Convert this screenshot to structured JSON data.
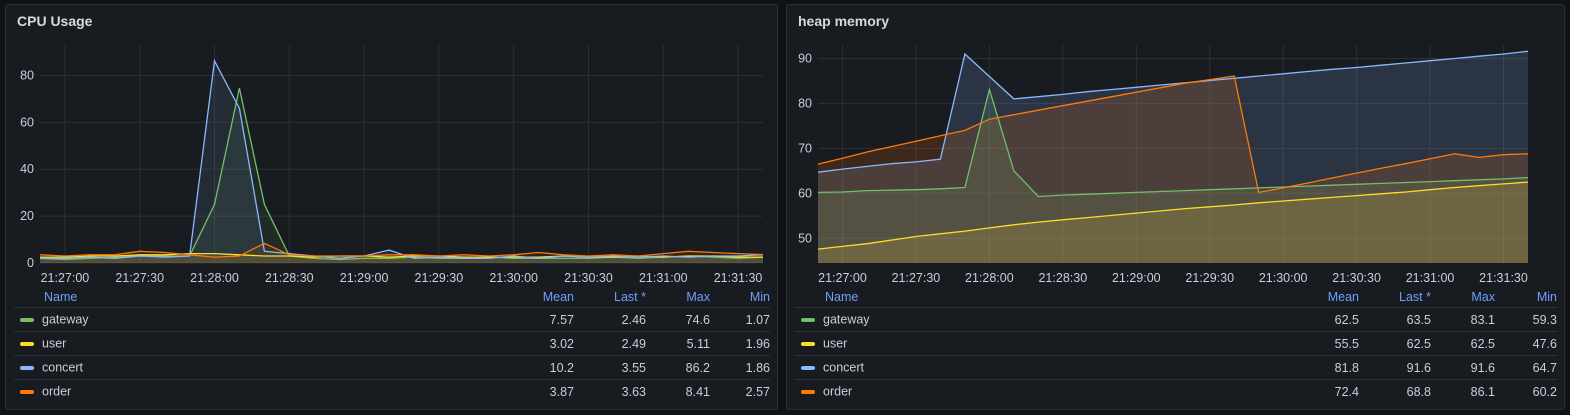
{
  "colors": {
    "gateway": "#73bf69",
    "user": "#fade2a",
    "concert": "#8ab8ff",
    "order": "#ff780a"
  },
  "panels": [
    {
      "title": "CPU Usage",
      "chart_data": {
        "type": "area",
        "x": [
          "21:26:50",
          "21:27:00",
          "21:27:10",
          "21:27:20",
          "21:27:30",
          "21:27:40",
          "21:27:50",
          "21:28:00",
          "21:28:10",
          "21:28:20",
          "21:28:30",
          "21:28:40",
          "21:28:50",
          "21:29:00",
          "21:29:10",
          "21:29:20",
          "21:29:30",
          "21:29:40",
          "21:29:50",
          "21:30:00",
          "21:30:10",
          "21:30:20",
          "21:30:30",
          "21:30:40",
          "21:30:50",
          "21:31:00",
          "21:31:10",
          "21:31:20",
          "21:31:30",
          "21:31:40"
        ],
        "xticks": [
          "21:27:00",
          "21:27:30",
          "21:28:00",
          "21:28:30",
          "21:29:00",
          "21:29:30",
          "21:30:00",
          "21:30:30",
          "21:31:00",
          "21:31:30"
        ],
        "yticks": [
          0,
          20,
          40,
          60,
          80
        ],
        "ylim": [
          0,
          93
        ],
        "series": [
          {
            "name": "gateway",
            "values": [
              2,
              1.5,
              2,
              2.5,
              3,
              3,
              3,
              25,
              74.6,
              25,
              3,
              2,
              1.5,
              2,
              2,
              2.5,
              2,
              2,
              2.5,
              2,
              2,
              2,
              2,
              2.5,
              2,
              2.5,
              3,
              2.5,
              2,
              2.46
            ]
          },
          {
            "name": "user",
            "values": [
              2.5,
              2.5,
              3,
              3,
              3.5,
              3.5,
              4,
              4,
              3.5,
              3,
              3,
              2.5,
              3,
              3,
              2.5,
              3,
              3,
              2.5,
              2.5,
              2.5,
              2.5,
              3,
              2.5,
              2.5,
              3,
              2.5,
              3,
              3,
              2.5,
              2.49
            ]
          },
          {
            "name": "concert",
            "values": [
              2,
              2,
              2.5,
              2,
              3,
              2.5,
              3,
              86.2,
              66,
              5,
              4,
              3,
              2,
              3,
              5.5,
              2,
              2.5,
              2,
              2,
              3,
              2,
              3,
              2.5,
              3,
              2.5,
              3,
              2.5,
              3,
              3,
              3.55
            ]
          },
          {
            "name": "order",
            "values": [
              3.5,
              3,
              3.5,
              3.5,
              5,
              4.5,
              3.5,
              2.5,
              3,
              8.41,
              3.5,
              3,
              3,
              3,
              3.5,
              3.5,
              3,
              3.5,
              3,
              3.5,
              4.5,
              3.5,
              3,
              3.5,
              3,
              4,
              5,
              4.5,
              4,
              3.63
            ]
          }
        ]
      },
      "legend": {
        "headers": {
          "name": "Name",
          "mean": "Mean",
          "last": "Last *",
          "max": "Max",
          "min": "Min"
        },
        "rows": [
          {
            "key": "gateway",
            "name": "gateway",
            "mean": "7.57",
            "last": "2.46",
            "max": "74.6",
            "min": "1.07"
          },
          {
            "key": "user",
            "name": "user",
            "mean": "3.02",
            "last": "2.49",
            "max": "5.11",
            "min": "1.96"
          },
          {
            "key": "concert",
            "name": "concert",
            "mean": "10.2",
            "last": "3.55",
            "max": "86.2",
            "min": "1.86"
          },
          {
            "key": "order",
            "name": "order",
            "mean": "3.87",
            "last": "3.63",
            "max": "8.41",
            "min": "2.57"
          }
        ]
      }
    },
    {
      "title": "heap memory",
      "chart_data": {
        "type": "area",
        "x": [
          "21:26:50",
          "21:27:00",
          "21:27:10",
          "21:27:20",
          "21:27:30",
          "21:27:40",
          "21:27:50",
          "21:28:00",
          "21:28:10",
          "21:28:20",
          "21:28:30",
          "21:28:40",
          "21:28:50",
          "21:29:00",
          "21:29:10",
          "21:29:20",
          "21:29:30",
          "21:29:40",
          "21:29:50",
          "21:30:00",
          "21:30:10",
          "21:30:20",
          "21:30:30",
          "21:30:40",
          "21:30:50",
          "21:31:00",
          "21:31:10",
          "21:31:20",
          "21:31:30",
          "21:31:40"
        ],
        "xticks": [
          "21:27:00",
          "21:27:30",
          "21:28:00",
          "21:28:30",
          "21:29:00",
          "21:29:30",
          "21:30:00",
          "21:30:30",
          "21:31:00",
          "21:31:30"
        ],
        "yticks": [
          50,
          60,
          70,
          80,
          90
        ],
        "ylim": [
          44.5,
          93
        ],
        "series": [
          {
            "name": "gateway",
            "values": [
              60.2,
              60.3,
              60.6,
              60.7,
              60.8,
              61,
              61.3,
              83.1,
              65,
              59.3,
              59.6,
              59.8,
              60,
              60.2,
              60.4,
              60.6,
              60.8,
              61,
              61.2,
              61.4,
              61.6,
              61.8,
              62,
              62.2,
              62.4,
              62.6,
              62.8,
              63,
              63.2,
              63.5
            ]
          },
          {
            "name": "user",
            "values": [
              47.6,
              48.2,
              48.8,
              49.6,
              50.4,
              51,
              51.6,
              52.3,
              53,
              53.6,
              54.1,
              54.6,
              55.1,
              55.6,
              56.1,
              56.6,
              57,
              57.4,
              57.9,
              58.3,
              58.7,
              59.1,
              59.5,
              59.9,
              60.3,
              60.8,
              61.3,
              61.7,
              62.1,
              62.5
            ]
          },
          {
            "name": "concert",
            "values": [
              64.7,
              65.4,
              66,
              66.6,
              67,
              67.6,
              91,
              86,
              81,
              81.5,
              82,
              82.6,
              83.1,
              83.6,
              84.1,
              84.6,
              85.1,
              85.6,
              86.1,
              86.6,
              87.1,
              87.6,
              88,
              88.5,
              89,
              89.5,
              90,
              90.5,
              91,
              91.6
            ]
          },
          {
            "name": "order",
            "values": [
              66.5,
              67.8,
              69.2,
              70.4,
              71.6,
              72.8,
              74,
              76.5,
              77.5,
              78.5,
              79.5,
              80.5,
              81.5,
              82.5,
              83.5,
              84.5,
              85.3,
              86.1,
              60.2,
              61.2,
              62.3,
              63.4,
              64.5,
              65.6,
              66.6,
              67.7,
              68.8,
              68,
              68.6,
              68.8
            ]
          }
        ]
      },
      "legend": {
        "headers": {
          "name": "Name",
          "mean": "Mean",
          "last": "Last *",
          "max": "Max",
          "min": "Min"
        },
        "rows": [
          {
            "key": "gateway",
            "name": "gateway",
            "mean": "62.5",
            "last": "63.5",
            "max": "83.1",
            "min": "59.3"
          },
          {
            "key": "user",
            "name": "user",
            "mean": "55.5",
            "last": "62.5",
            "max": "62.5",
            "min": "47.6"
          },
          {
            "key": "concert",
            "name": "concert",
            "mean": "81.8",
            "last": "91.6",
            "max": "91.6",
            "min": "64.7"
          },
          {
            "key": "order",
            "name": "order",
            "mean": "72.4",
            "last": "68.8",
            "max": "86.1",
            "min": "60.2"
          }
        ]
      }
    }
  ]
}
